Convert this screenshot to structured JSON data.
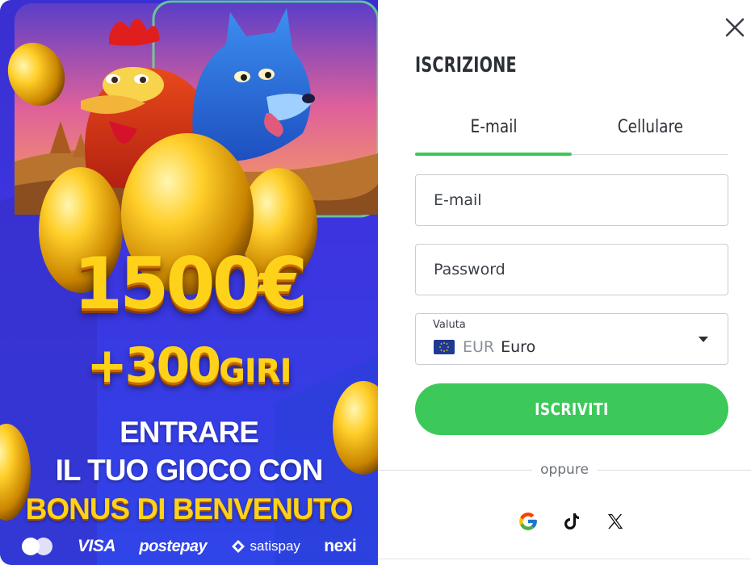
{
  "promo": {
    "amount": "1500€",
    "spins_number": "+300",
    "spins_word": "GIRI",
    "line1": "ENTRARE",
    "line2": "IL TUO GIOCO CON",
    "line3": "BONUS DI BENVENUTO",
    "payments": [
      "VISA",
      "postepay",
      "satispay",
      "nexi"
    ],
    "colors": {
      "gold": "#ffd21a",
      "blue": "#3a35e0"
    }
  },
  "form": {
    "title": "ISCRIZIONE",
    "tabs": [
      {
        "label": "E-mail",
        "active": true
      },
      {
        "label": "Cellulare",
        "active": false
      }
    ],
    "email_placeholder": "E-mail",
    "password_placeholder": "Password",
    "currency": {
      "label": "Valuta",
      "code": "EUR",
      "name": "Euro",
      "flag": "eu-flag-icon"
    },
    "submit_label": "ISCRIVITI",
    "divider_text": "oppure",
    "social_icons": [
      "google-icon",
      "tiktok-icon",
      "x-icon"
    ],
    "colors": {
      "accent": "#3cc95a",
      "text": "#2b2f36",
      "border": "#c9cdd3"
    }
  }
}
